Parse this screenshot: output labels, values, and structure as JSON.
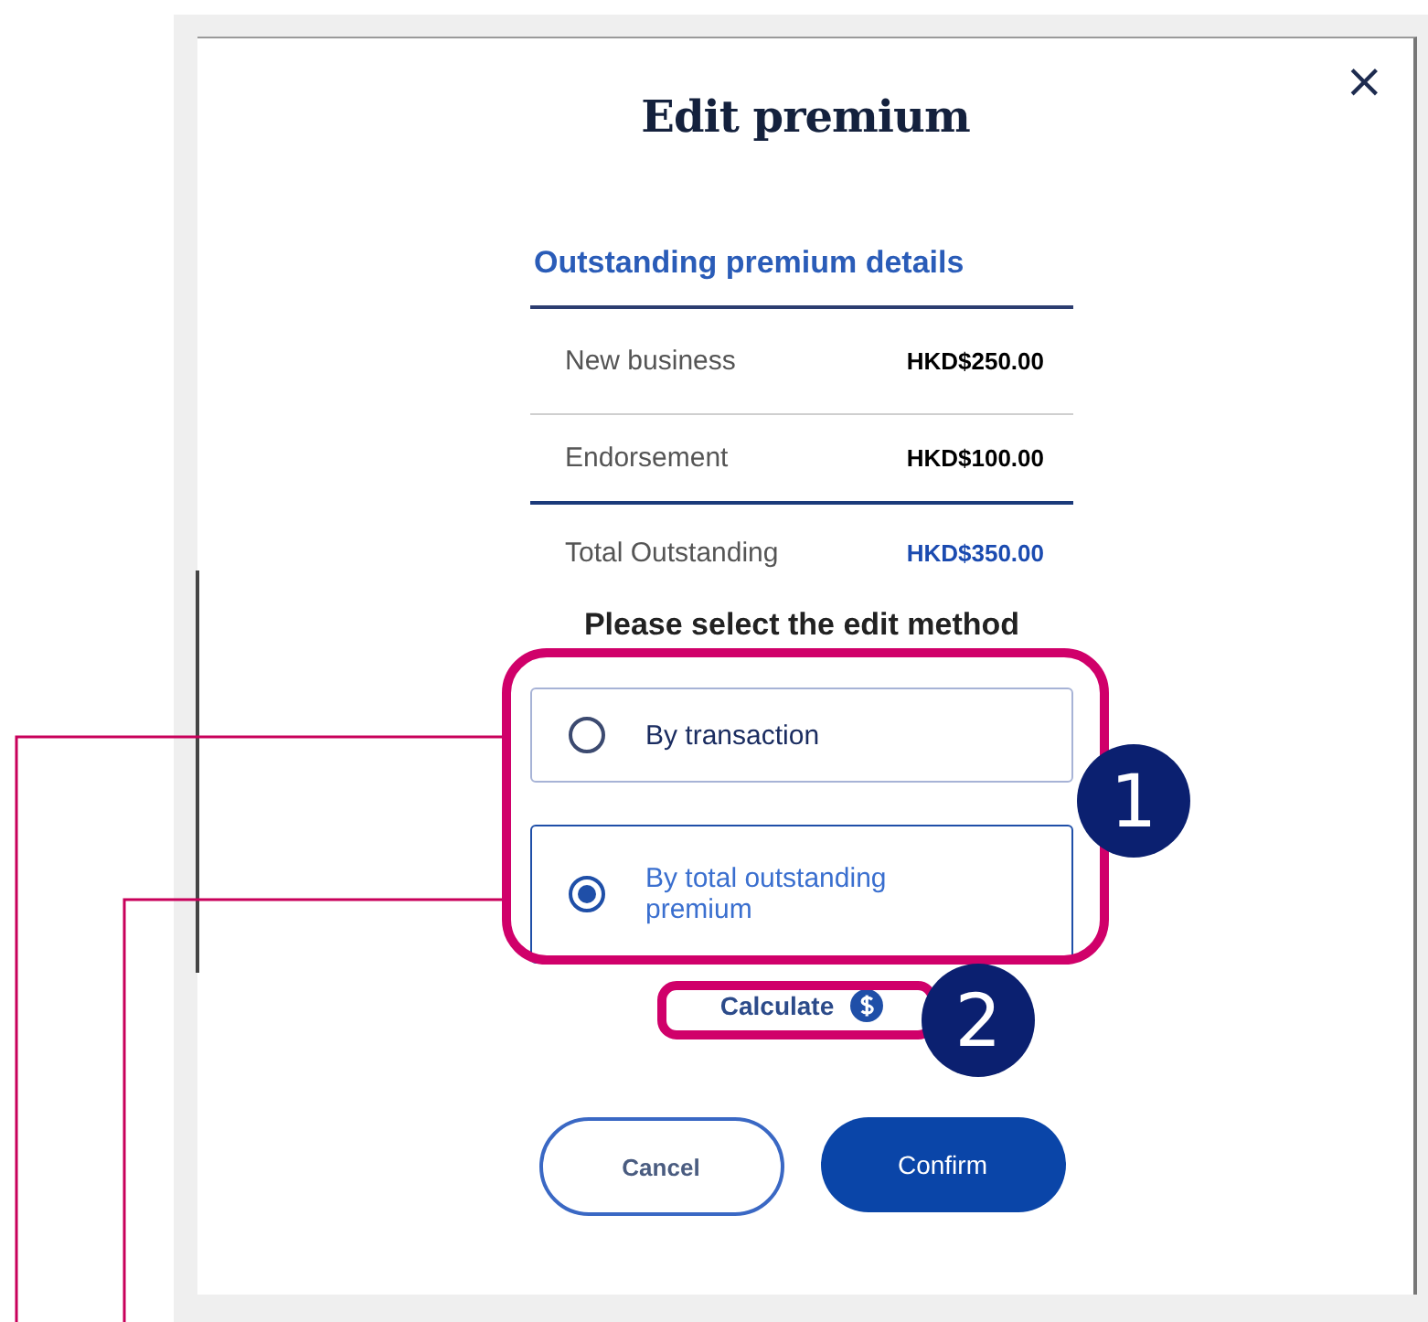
{
  "dialog": {
    "title": "Edit premium",
    "close": "×"
  },
  "details": {
    "heading": "Outstanding premium details",
    "rows": [
      {
        "kind": "item",
        "label": "New business",
        "amount": "HKD$250.00"
      },
      {
        "kind": "item",
        "label": "Endorsement",
        "amount": "HKD$100.00"
      },
      {
        "kind": "total",
        "label": "Total Outstanding",
        "amount": "HKD$350.00"
      }
    ]
  },
  "method": {
    "prompt": "Please select the edit method",
    "options": [
      {
        "label": "By transaction",
        "selected": false
      },
      {
        "label": "By total outstanding premium",
        "selected": true
      }
    ]
  },
  "calculate": {
    "label": "Calculate"
  },
  "buttons": [
    {
      "kind": "secondary",
      "label": "Cancel"
    },
    {
      "kind": "primary",
      "label": "Confirm"
    }
  ],
  "annotations": [
    {
      "label": "1"
    },
    {
      "label": "2"
    }
  ]
}
